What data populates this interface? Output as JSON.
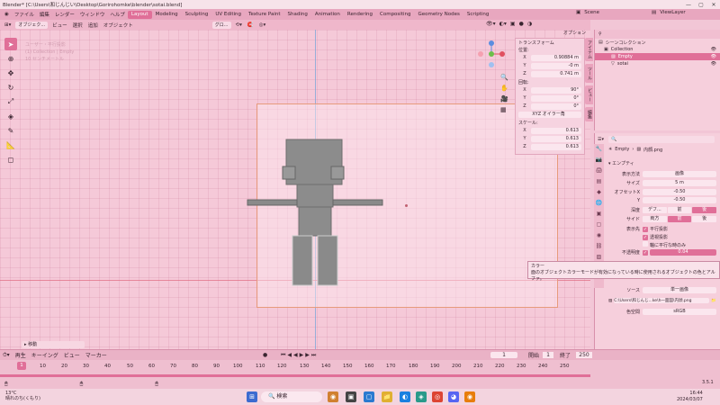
{
  "title_bar": {
    "text": "Blender* [C:\\Users\\和じんじい\\Desktop\\Gorirohomke\\blender\\sotai.blend]",
    "min": "—",
    "max": "▢",
    "close": "✕"
  },
  "menu": {
    "items": [
      "ファイル",
      "編集",
      "レンダー",
      "ウィンドウ",
      "ヘルプ"
    ],
    "tabs": [
      "Layout",
      "Modeling",
      "Sculpting",
      "UV Editing",
      "Texture Paint",
      "Shading",
      "Animation",
      "Rendering",
      "Compositing",
      "Geometry Nodes",
      "Scripting"
    ],
    "scene": "Scene",
    "view_layer": "ViewLayer"
  },
  "viewport_header": {
    "mode": "オブジェク...",
    "items": [
      "ビュー",
      "選択",
      "追加",
      "オブジェクト"
    ],
    "transform": "グロ...",
    "options": "オプション"
  },
  "viewport_overlay": {
    "line1": "ユーザー・平行投影",
    "line2": "(1) Collection | Empty",
    "line3": "10 センチメートル"
  },
  "n_panel": {
    "header": "トランスフォーム",
    "location_label": "位置:",
    "location": [
      {
        "axis": "X",
        "value": "0.90884 m"
      },
      {
        "axis": "Y",
        "value": "-0 m"
      },
      {
        "axis": "Z",
        "value": "0.741 m"
      }
    ],
    "rotation_label": "回転:",
    "rotation": [
      {
        "axis": "X",
        "value": "90°"
      },
      {
        "axis": "Y",
        "value": "0°"
      },
      {
        "axis": "Z",
        "value": "0°"
      }
    ],
    "rotation_mode": "XYZ オイラー角",
    "scale_label": "スケール:",
    "scale": [
      {
        "axis": "X",
        "value": "0.613"
      },
      {
        "axis": "Y",
        "value": "0.613"
      },
      {
        "axis": "Z",
        "value": "0.613"
      }
    ],
    "tabs": [
      "アイテム",
      "ツール",
      "ビュー",
      "編集"
    ]
  },
  "outliner": {
    "header": "シーンコレクション",
    "rows": [
      {
        "label": "Collection"
      },
      {
        "label": "Empty"
      },
      {
        "label": "sotai"
      }
    ]
  },
  "properties": {
    "breadcrumb_object": "Empty",
    "breadcrumb_image": "内顔.png",
    "section": "エンプティ",
    "display_label": "表示方法",
    "display_value": "画像",
    "size_label": "サイズ",
    "size_value": "5 m",
    "offset_x_label": "オフセットX",
    "offset_x_value": "-0.50",
    "offset_y_label": "Y",
    "offset_y_value": "-0.50",
    "depth_label": "深度",
    "depth_opts": [
      "デフ...",
      "前",
      "後"
    ],
    "side_label": "サイド",
    "side_opts": [
      "両方",
      "前",
      "後"
    ],
    "show_label": "表示先",
    "show_ortho": "平行投影",
    "show_persp": "透視投影",
    "show_axis": "軸に平行な時のみ",
    "opacity_label": "不透明度",
    "opacity_value": "0.04",
    "source_label": "ソース",
    "source_value": "単一画像",
    "file_path": "C:\\Users\\和じんじ...ke\\h一面図\\内顔.png",
    "colorspace_label": "色空間",
    "colorspace_value": "sRGB"
  },
  "tooltip": {
    "title": "カラー",
    "body": "面のオブジェクトカラーモードが有効になっている時に使用されるオブジェクトの色とアルファ。"
  },
  "timeline": {
    "items": [
      "再生",
      "キーイング",
      "ビュー",
      "マーカー"
    ],
    "current": "1",
    "start_label": "開始",
    "start": "1",
    "end_label": "終了",
    "end": "250",
    "ticks": [
      "1",
      "10",
      "20",
      "30",
      "40",
      "50",
      "60",
      "70",
      "80",
      "90",
      "100",
      "110",
      "120",
      "130",
      "140",
      "150",
      "160",
      "170",
      "180",
      "190",
      "200",
      "210",
      "220",
      "230",
      "240",
      "250"
    ],
    "status_left": "移動",
    "version": "3.5.1"
  },
  "taskbar": {
    "weather_temp": "13°C",
    "weather_desc": "晴れのち(くもり)",
    "search": "検索",
    "time": "16:44",
    "date": "2024/03/07"
  }
}
